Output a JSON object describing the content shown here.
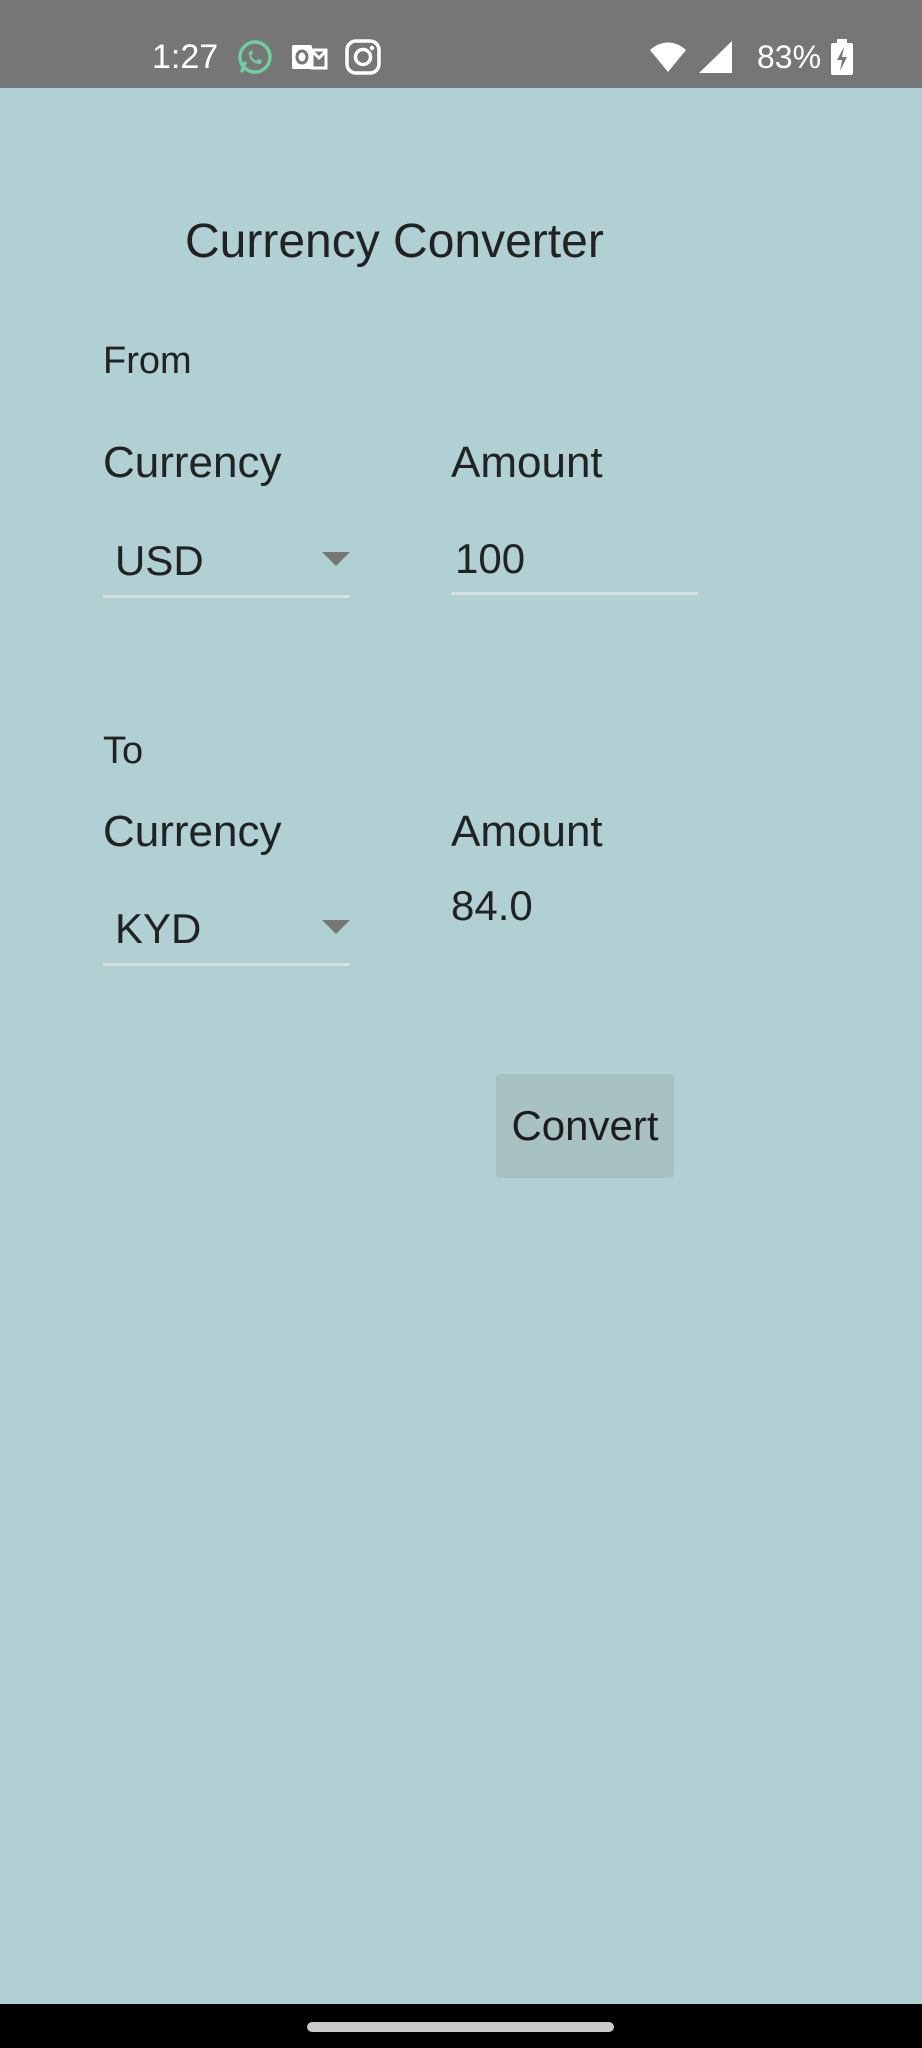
{
  "status_bar": {
    "time": "1:27",
    "battery": "83%",
    "icons": [
      "whatsapp-icon",
      "outlook-icon",
      "instagram-icon",
      "wifi-icon",
      "signal-icon",
      "battery-charging-icon"
    ]
  },
  "app": {
    "title": "Currency Converter"
  },
  "from": {
    "section_label": "From",
    "currency_label": "Currency",
    "currency_value": "USD",
    "amount_label": "Amount",
    "amount_value": "100"
  },
  "to": {
    "section_label": "To",
    "currency_label": "Currency",
    "currency_value": "KYD",
    "amount_label": "Amount",
    "amount_value": "84.0"
  },
  "actions": {
    "convert_label": "Convert"
  },
  "colors": {
    "background": "#b0d0d3",
    "status_bar": "#767676",
    "button": "#a8c2c3",
    "whatsapp": "#25d366"
  }
}
